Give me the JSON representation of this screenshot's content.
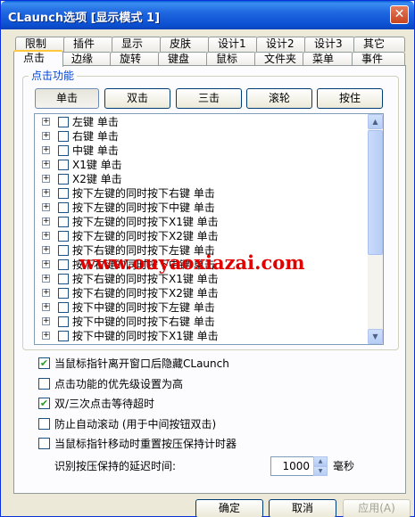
{
  "window": {
    "title": "CLaunch选项 [显示模式 1]",
    "close_icon": "close-icon"
  },
  "tabs_row1": [
    "限制",
    "插件",
    "显示",
    "皮肤",
    "设计1",
    "设计2",
    "设计3",
    "其它"
  ],
  "tabs_row2": [
    "点击",
    "边缘",
    "旋转",
    "键盘",
    "鼠标",
    "文件夹",
    "菜单",
    "事件"
  ],
  "active_tab": "点击",
  "click_group": {
    "title": "点击功能",
    "buttons": [
      "单击",
      "双击",
      "三击",
      "滚轮",
      "按住"
    ],
    "selected_button": "单击",
    "tree_items": [
      "左键 单击",
      "右键 单击",
      "中键 单击",
      "X1键 单击",
      "X2键 单击",
      "按下左键的同时按下右键 单击",
      "按下左键的同时按下中键 单击",
      "按下左键的同时按下X1键 单击",
      "按下左键的同时按下X2键 单击",
      "按下右键的同时按下左键 单击",
      "按下右键的同时按下中键 单击",
      "按下右键的同时按下X1键 单击",
      "按下右键的同时按下X2键 单击",
      "按下中键的同时按下左键 单击",
      "按下中键的同时按下右键 单击",
      "按下中键的同时按下X1键 单击"
    ]
  },
  "watermark": "www.ouyaoxiazai.com",
  "options": [
    {
      "label": "当鼠标指针离开窗口后隐藏CLaunch",
      "checked": true
    },
    {
      "label": "点击功能的优先级设置为高",
      "checked": false
    },
    {
      "label": "双/三次点击等待超时",
      "checked": true
    },
    {
      "label": "防止自动滚动 (用于中间按钮双击)",
      "checked": false
    },
    {
      "label": "当鼠标指针移动时重置按压保持计时器",
      "checked": false
    }
  ],
  "delay": {
    "label": "识别按压保持的延迟时间:",
    "value": "1000",
    "unit": "毫秒"
  },
  "footer": {
    "ok": "确定",
    "cancel": "取消",
    "apply": "应用(A)"
  },
  "colors": {
    "title_bar": "#0a5fd8",
    "group_title": "#0046d5",
    "watermark": "#e00000",
    "check": "#21a121"
  }
}
